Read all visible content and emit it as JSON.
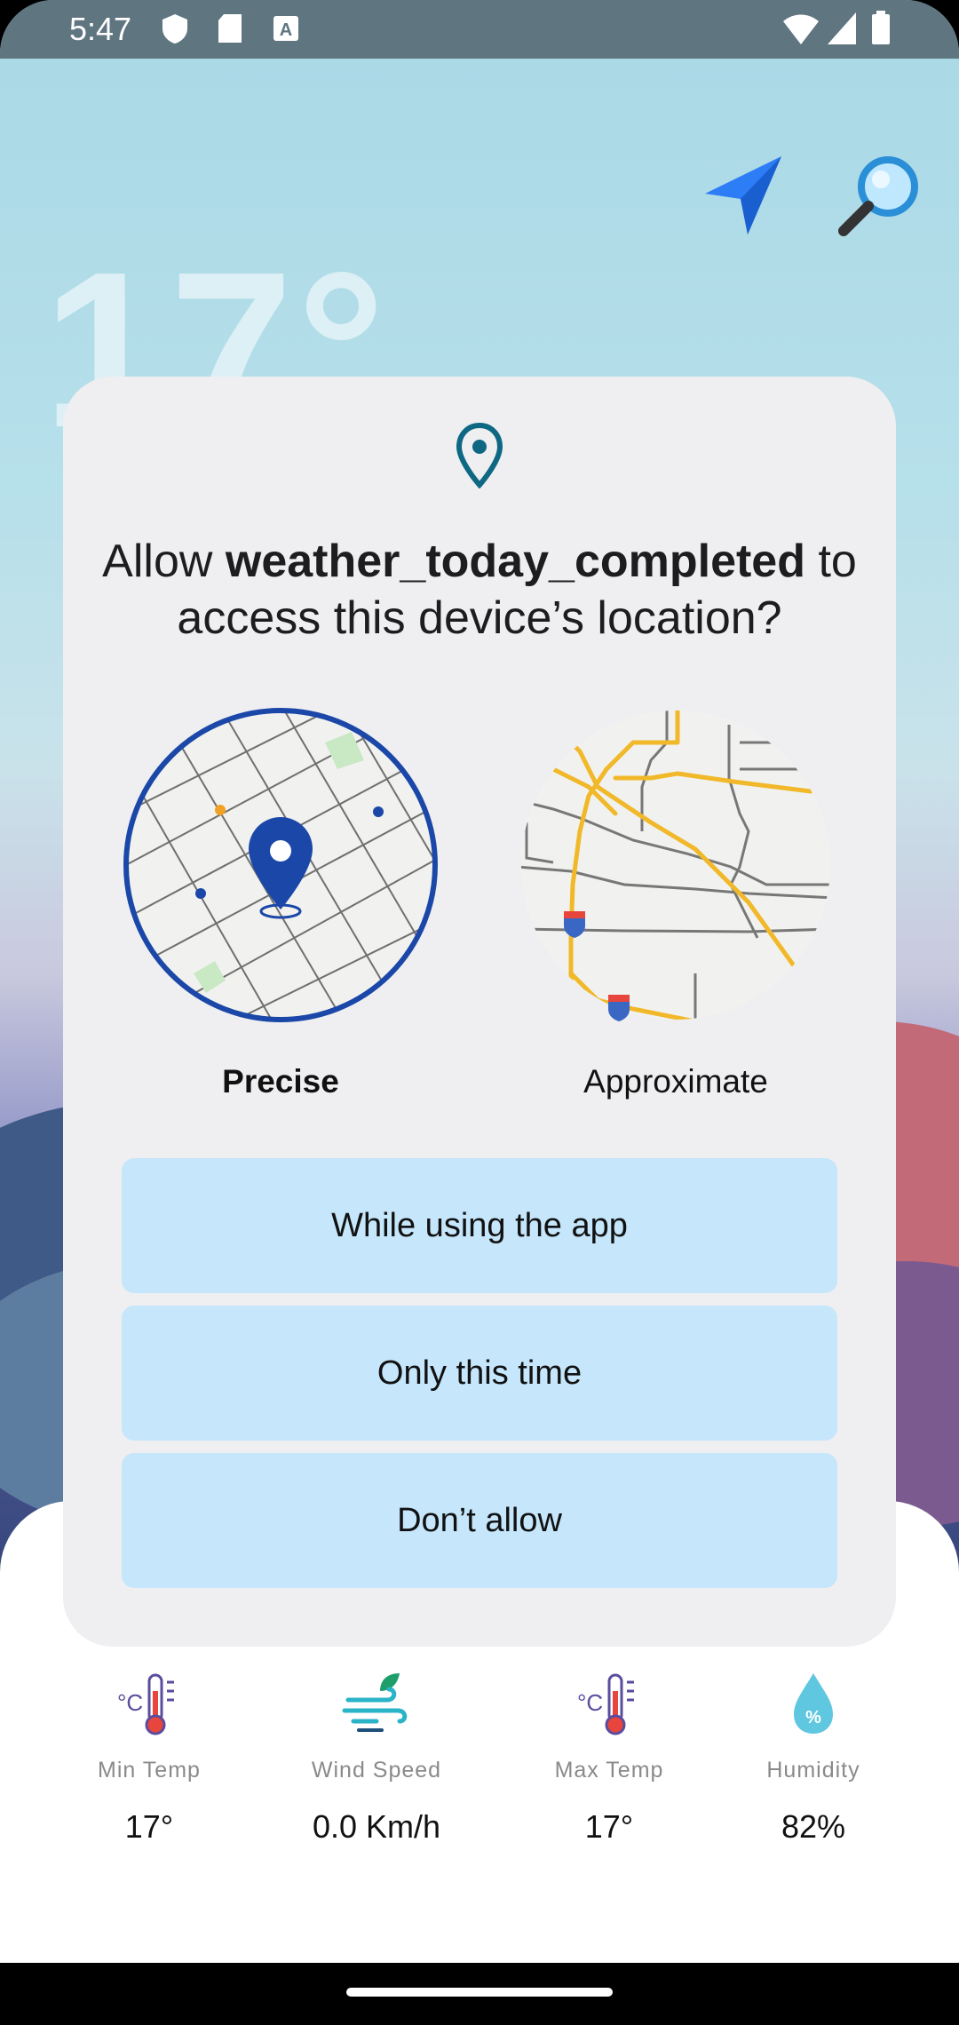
{
  "status_bar": {
    "time": "5:47"
  },
  "background": {
    "temperature": "17°"
  },
  "dialog": {
    "title_prefix": "Allow ",
    "app_name": "weather_today_completed",
    "title_suffix": " to access this device’s location?",
    "options": {
      "precise": "Precise",
      "approximate": "Approximate"
    },
    "buttons": {
      "while_using": "While using the app",
      "only_this_time": "Only this time",
      "dont_allow": "Don’t allow"
    },
    "button_color": "#c5e6fb"
  },
  "stats": [
    {
      "label": "Min Temp",
      "value": "17°",
      "icon": "thermometer-celsius-icon"
    },
    {
      "label": "Wind Speed",
      "value": "0.0 Km/h",
      "icon": "wind-icon"
    },
    {
      "label": "Max Temp",
      "value": "17°",
      "icon": "thermometer-celsius-icon"
    },
    {
      "label": "Humidity",
      "value": "82%",
      "icon": "humidity-drop-icon"
    }
  ],
  "colors": {
    "accent": "#1a47a8",
    "map_road": "#f1b82a",
    "locate": "#2d7df6"
  }
}
